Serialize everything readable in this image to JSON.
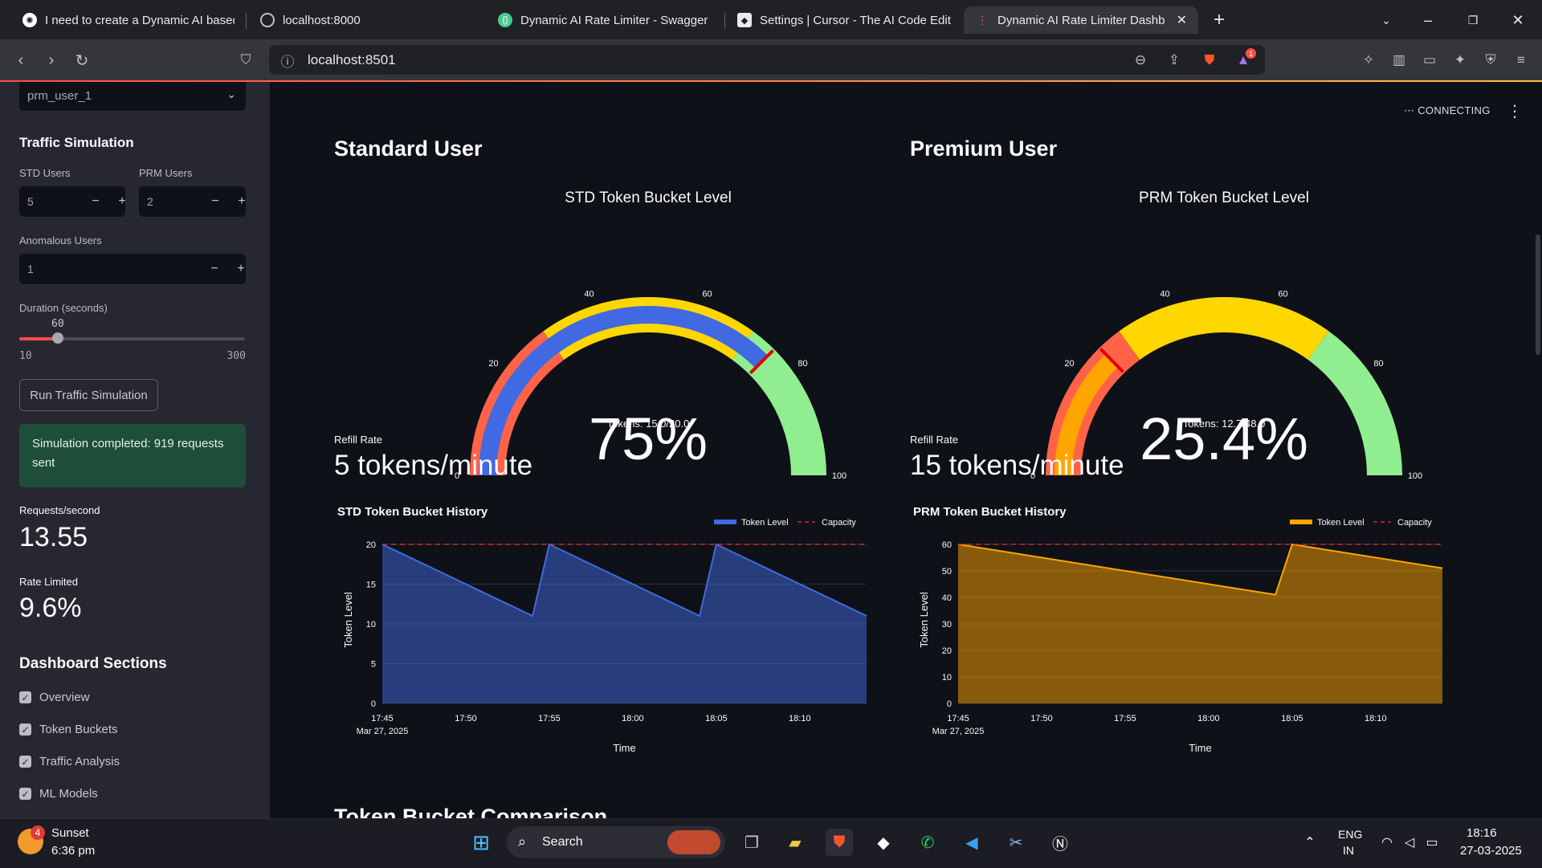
{
  "browser": {
    "tabs": [
      {
        "label": "I need to create a Dynamic AI based",
        "icon": "chatgpt-icon"
      },
      {
        "label": "localhost:8000",
        "icon": "globe-icon"
      },
      {
        "label": "Dynamic AI Rate Limiter - Swagger",
        "icon": "swagger-icon"
      },
      {
        "label": "Settings | Cursor - The AI Code Edit",
        "icon": "cursor-icon"
      },
      {
        "label": "Dynamic AI Rate Limiter Dashb",
        "icon": "streamlit-icon",
        "active": true
      }
    ],
    "url": "localhost:8501",
    "notification_count": "1"
  },
  "sidebar": {
    "selected_user": "prm_user_1",
    "traffic_title": "Traffic Simulation",
    "std_users": {
      "label": "STD Users",
      "value": "5"
    },
    "prm_users": {
      "label": "PRM Users",
      "value": "2"
    },
    "anomalous_users": {
      "label": "Anomalous Users",
      "value": "1"
    },
    "duration": {
      "label": "Duration (seconds)",
      "value": "60",
      "min": "10",
      "max": "300",
      "fraction": 0.172
    },
    "run_button": "Run Traffic Simulation",
    "success_message": "Simulation completed: 919 requests sent",
    "requests_per_second": {
      "label": "Requests/second",
      "value": "13.55"
    },
    "rate_limited": {
      "label": "Rate Limited",
      "value": "9.6%"
    },
    "sections_title": "Dashboard Sections",
    "sections": [
      {
        "label": "Overview",
        "checked": true
      },
      {
        "label": "Token Buckets",
        "checked": true
      },
      {
        "label": "Traffic Analysis",
        "checked": true
      },
      {
        "label": "ML Models",
        "checked": true
      }
    ]
  },
  "main": {
    "status": "CONNECTING",
    "standard": {
      "title": "Standard User",
      "gauge_title": "STD Token Bucket Level",
      "gauge_value_text": "75%",
      "gauge_sub_text": "Tokens: 15.0/20.0",
      "refill_label": "Refill Rate",
      "refill_value": "5 tokens/minute"
    },
    "premium": {
      "title": "Premium User",
      "gauge_title": "PRM Token Bucket Level",
      "gauge_value_text": "25.4%",
      "gauge_sub_text": "Tokens: 12.7/48.0",
      "refill_label": "Refill Rate",
      "refill_value": "15 tokens/minute"
    },
    "next_section_title": "Token Bucket Comparison"
  },
  "colors": {
    "std_series": "#4169e1",
    "prm_series": "#ffa500",
    "capacity_line": "#d62728",
    "gauge_red": "#ff6347",
    "gauge_yellow": "#ffd700",
    "gauge_green": "#90ee90",
    "success_bg": "#1f4e38"
  },
  "chart_data": [
    {
      "type": "gauge",
      "title": "STD Token Bucket Level",
      "value": 75,
      "range": [
        0,
        100
      ],
      "ticks": [
        "0",
        "20",
        "40",
        "60",
        "80",
        "100"
      ],
      "steps": [
        {
          "range": [
            0,
            30
          ],
          "color": "#ff6347"
        },
        {
          "range": [
            30,
            70
          ],
          "color": "#ffd700"
        },
        {
          "range": [
            70,
            100
          ],
          "color": "#90ee90"
        }
      ],
      "threshold": 75,
      "bar_color": "#4169e1",
      "value_text": "75%",
      "annotation": "Tokens: 15.0/20.0"
    },
    {
      "type": "gauge",
      "title": "PRM Token Bucket Level",
      "value": 25.4,
      "range": [
        0,
        100
      ],
      "ticks": [
        "0",
        "20",
        "40",
        "60",
        "80",
        "100"
      ],
      "steps": [
        {
          "range": [
            0,
            30
          ],
          "color": "#ff6347"
        },
        {
          "range": [
            30,
            70
          ],
          "color": "#ffd700"
        },
        {
          "range": [
            70,
            100
          ],
          "color": "#90ee90"
        }
      ],
      "threshold": 25.4,
      "bar_color": "#ffa500",
      "value_text": "25.4%",
      "annotation": "Tokens: 12.7/48.0"
    },
    {
      "type": "area",
      "title": "STD Token Bucket History",
      "xlabel": "Time",
      "ylabel": "Token Level",
      "x_ticks": [
        "17:45",
        "17:50",
        "17:55",
        "18:00",
        "18:05",
        "18:10"
      ],
      "x_date_label": "Mar 27, 2025",
      "x_range": [
        "17:45",
        "18:14"
      ],
      "ylim": [
        0,
        21
      ],
      "y_ticks": [
        0,
        5,
        10,
        15,
        20
      ],
      "series": [
        {
          "name": "Token Level",
          "color": "#4169e1",
          "x": [
            "17:45",
            "17:54",
            "17:55",
            "18:04",
            "18:05",
            "18:14"
          ],
          "y": [
            20,
            11,
            20,
            11,
            20,
            11
          ]
        }
      ],
      "capacity": {
        "name": "Capacity",
        "value": 20,
        "color": "#d62728"
      },
      "legend": "top-right"
    },
    {
      "type": "area",
      "title": "PRM Token Bucket History",
      "xlabel": "Time",
      "ylabel": "Token Level",
      "x_ticks": [
        "17:45",
        "17:50",
        "17:55",
        "18:00",
        "18:05",
        "18:10"
      ],
      "x_date_label": "Mar 27, 2025",
      "x_range": [
        "17:45",
        "18:14"
      ],
      "ylim": [
        0,
        63
      ],
      "y_ticks": [
        0,
        10,
        20,
        30,
        40,
        50,
        60
      ],
      "series": [
        {
          "name": "Token Level",
          "color": "#ffa500",
          "x": [
            "17:45",
            "18:04",
            "18:05",
            "18:14"
          ],
          "y": [
            60,
            41,
            60,
            51
          ]
        }
      ],
      "capacity": {
        "name": "Capacity",
        "value": 60,
        "color": "#d62728"
      },
      "legend": "top-right"
    }
  ],
  "taskbar": {
    "weather_badge": "4",
    "weather_title": "Sunset",
    "weather_time": "6:36 pm",
    "search_label": "Search",
    "lang_line1": "ENG",
    "lang_line2": "IN",
    "clock_time": "18:16",
    "clock_date": "27-03-2025"
  }
}
